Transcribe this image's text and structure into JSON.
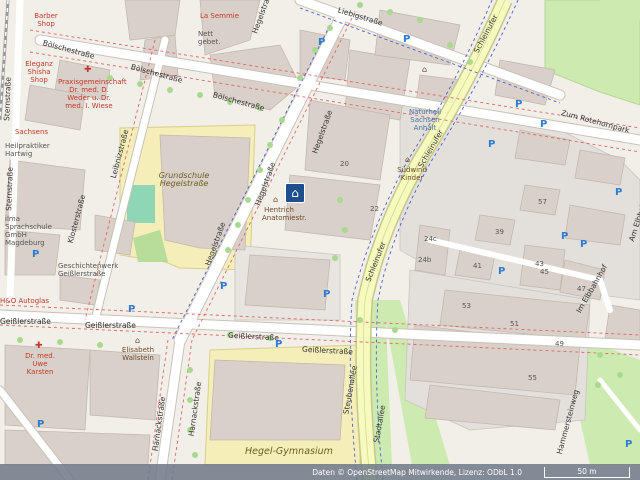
{
  "map": {
    "streets": {
      "liebigstrasse": "Liebigstraße",
      "boelschestrasse_top": "Bölschestraße",
      "boelschestrasse_mid": "Bölschestraße",
      "boelschestrasse_low": "Bölschestraße",
      "hegelstrasse_1": "Hegelstraße",
      "hegelstrasse_2": "Hegelstraße",
      "hegelstrasse_3": "Hegelstraße",
      "hegelstrasse_4": "Hegelstraße",
      "leibnizstrasse": "Leibnizstraße",
      "klosterstrasse": "Klosterstraße",
      "geisslerstrasse_1": "Geißlerstraße",
      "geisslerstrasse_2": "Geißlerstraße",
      "geisslerstrasse_3": "Geißlerstraße",
      "geisslerstrasse_4": "Geißlerstraße",
      "schleinufer_1": "Schleinufer",
      "schleinufer_2": "Schleinufer",
      "schleinufer_3": "Schleinufer",
      "zum_rotehornpark": "Zum Rotehornpark",
      "im_elbbahnhof": "Im Elbbahnhof",
      "am_elbbahnhof": "Am Elbbahnhof",
      "harnackstrasse_1": "Harnackstraße",
      "harnackstrasse_2": "Harnackstraße",
      "hammersteinweg": "Hammersteinweg",
      "steubenallee": "Steubenallee",
      "glockenstrasse": "Stadtallee",
      "sternstrasse_1": "Sternstraße",
      "sternstrasse_2": "Sternstraße"
    },
    "pois": {
      "praxis": "Praxisgemeinschaft Dr. med. D. Weder u. Dr. med. I. Wiese",
      "barber": "Barber Shop",
      "lasemmie": "La Semmie",
      "nett": "Nett gebet.",
      "eleganz": "Eleganz Shisha Shop",
      "sachsens": "Sachsens",
      "heilpraktiker": "Heilpraktiker Hartwig",
      "grundschule": "Grundschule Hegelstraße",
      "ilma": "ilma Sprachschule GmbH Magdeburg",
      "geschichtenwerk": "Geschichtenwerk Geißlerstraße",
      "autoglas": "H&O Autoglas",
      "hentrich": "Hentrich Anatomiestr.",
      "dr_karsten": "Dr. med. Uwe Karsten",
      "elisabeth": "Elisabeth Wallstein",
      "naturheil": "Naturheil Sachsen Anhalt",
      "sudwind": "Südwind Kinder",
      "hegel_gymnasium": "Hegel-Gymnasium"
    },
    "parking_label": "P",
    "home_pin_icon": "home-icon",
    "house_numbers": [
      "22",
      "20",
      "39",
      "41",
      "43",
      "45",
      "47",
      "49",
      "51",
      "53",
      "55",
      "57",
      "24c",
      "24b"
    ]
  },
  "footer": {
    "attribution": "Daten © OpenStreetMap Mitwirkende, Lizenz: ODbL 1.0",
    "scale_label": "50 m"
  },
  "colors": {
    "background": "#f2efe9",
    "building": "#d9d0c9",
    "school_ground": "#f5eeb8",
    "park": "#c8e6a8",
    "primary_road": "#f6fabe",
    "primary_road_casing": "#c5c88a",
    "parking_symbol": "#2e7bcf",
    "pin": "#1f4e8c"
  }
}
